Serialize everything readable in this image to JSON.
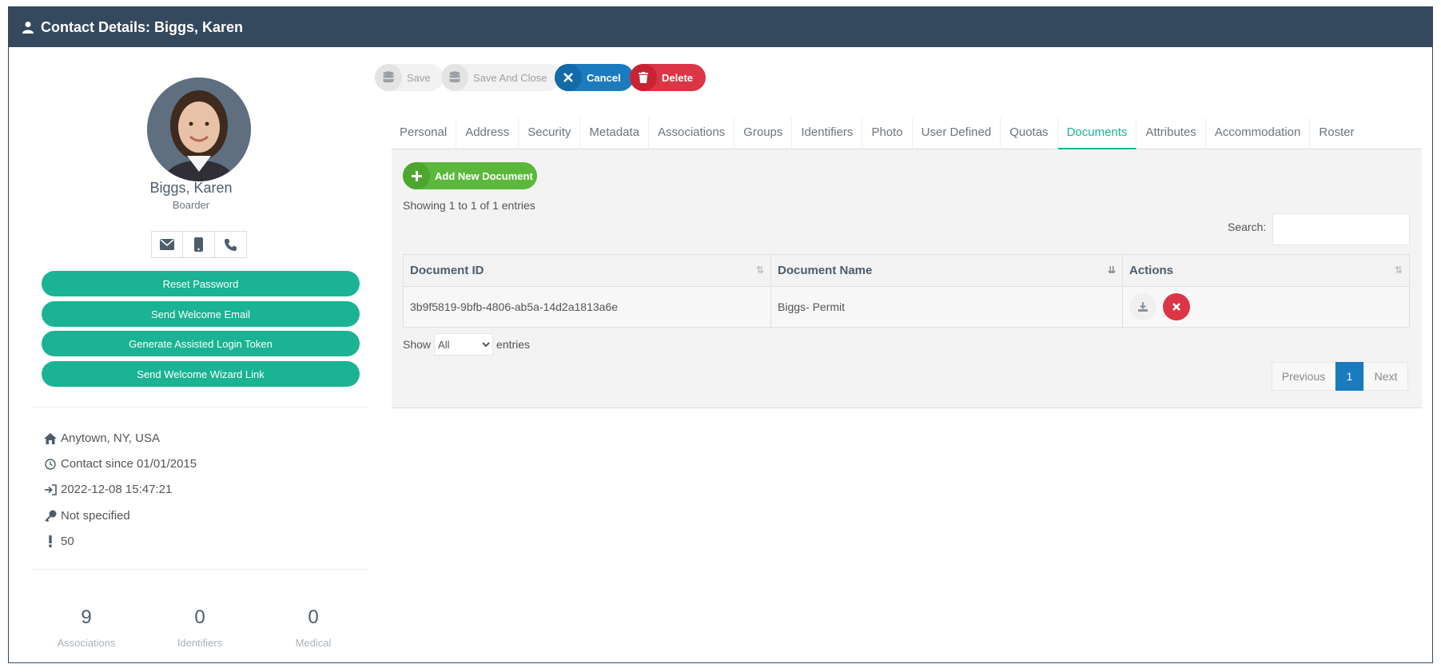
{
  "header": {
    "title": "Contact Details: Biggs, Karen"
  },
  "profile": {
    "name": "Biggs, Karen",
    "role": "Boarder",
    "buttons": [
      "Reset Password",
      "Send Welcome Email",
      "Generate Assisted Login Token",
      "Send Welcome Wizard Link"
    ],
    "info": {
      "location": "Anytown, NY, USA",
      "contact_since": "Contact since 01/01/2015",
      "last_login": "2022-12-08 15:47:21",
      "password": "Not specified",
      "priority": "50"
    },
    "stats": [
      {
        "value": "9",
        "label": "Associations"
      },
      {
        "value": "0",
        "label": "Identifiers"
      },
      {
        "value": "0",
        "label": "Medical"
      }
    ]
  },
  "toolbar": {
    "save": "Save",
    "save_close": "Save And Close",
    "cancel": "Cancel",
    "delete": "Delete"
  },
  "tabs": [
    "Personal",
    "Address",
    "Security",
    "Metadata",
    "Associations",
    "Groups",
    "Identifiers",
    "Photo",
    "User Defined",
    "Quotas",
    "Documents",
    "Attributes",
    "Accommodation",
    "Roster"
  ],
  "active_tab": "Documents",
  "documents": {
    "add_label": "Add New Document",
    "showing": "Showing 1 to 1 of 1 entries",
    "search_label": "Search:",
    "search_value": "",
    "columns": [
      "Document ID",
      "Document Name",
      "Actions"
    ],
    "rows": [
      {
        "id": "3b9f5819-9bfb-4806-ab5a-14d2a1813a6e",
        "name": "Biggs- Permit"
      }
    ],
    "show_label": "Show",
    "show_value": "All",
    "entries_label": "entries",
    "pager": {
      "previous": "Previous",
      "page": "1",
      "next": "Next"
    }
  },
  "colors": {
    "header_bg": "#34495e",
    "primary_green": "#1ab394",
    "add_green": "#5cb83c",
    "cancel_blue": "#1a7bbf",
    "delete_red": "#dc3545"
  }
}
